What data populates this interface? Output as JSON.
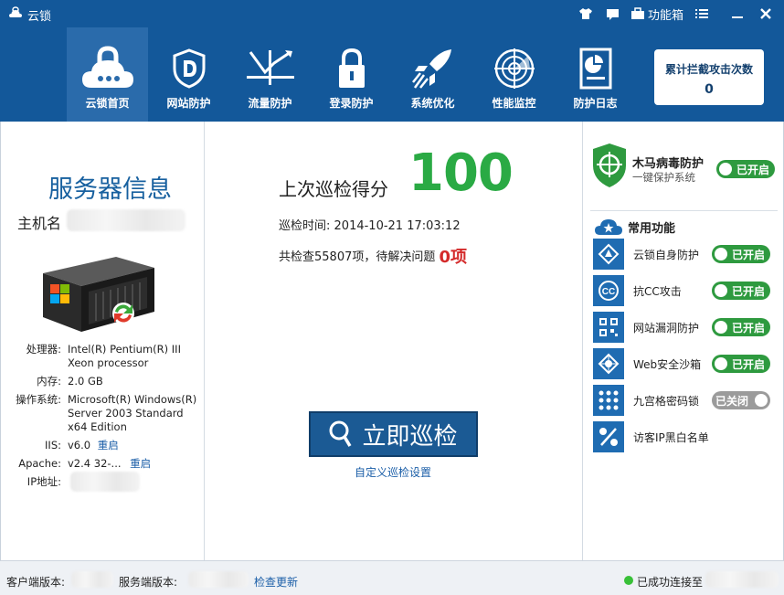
{
  "app": {
    "title": "云锁"
  },
  "titlebar": {
    "toolbox_label": "功能箱"
  },
  "nav": [
    {
      "label": "云锁首页",
      "icon": "cloud-lock-icon"
    },
    {
      "label": "网站防护",
      "icon": "shield-d-icon"
    },
    {
      "label": "流量防护",
      "icon": "traffic-icon"
    },
    {
      "label": "登录防护",
      "icon": "padlock-icon"
    },
    {
      "label": "系统优化",
      "icon": "rocket-icon"
    },
    {
      "label": "性能监控",
      "icon": "radar-icon"
    },
    {
      "label": "防护日志",
      "icon": "log-icon"
    }
  ],
  "attack_counter": {
    "label": "累计拦截攻击次数",
    "count": "0"
  },
  "server": {
    "title": "服务器信息",
    "host_label": "主机名",
    "specs": [
      {
        "key": "处理器:",
        "value": "Intel(R) Pentium(R) III Xeon processor"
      },
      {
        "key": "内存:",
        "value": "2.0 GB"
      },
      {
        "key": "操作系统:",
        "value": "Microsoft(R) Windows(R) Server 2003 Standard x64 Edition"
      },
      {
        "key": "IIS:",
        "value": "v6.0",
        "action": "重启"
      },
      {
        "key": "Apache:",
        "value": "v2.4 32-...",
        "action": "重启"
      },
      {
        "key": "IP地址:",
        "value": ""
      }
    ]
  },
  "check": {
    "score_label": "上次巡检得分",
    "score": "100",
    "time_label": "巡检时间:",
    "time_value": "2014-10-21 17:03:12",
    "summary_prefix": "共检查55807项，待解决问题",
    "issues": "0项",
    "scan_button": "立即巡检",
    "custom_link": "自定义巡检设置"
  },
  "trojan": {
    "title": "木马病毒防护",
    "subtitle": "一键保护系统",
    "status": "已开启"
  },
  "common": {
    "title": "常用功能",
    "items": [
      {
        "label": "云锁自身防护",
        "status": "已开启",
        "on": true,
        "icon": "self-protect-icon"
      },
      {
        "label": "抗CC攻击",
        "status": "已开启",
        "on": true,
        "icon": "cc-icon"
      },
      {
        "label": "网站漏洞防护",
        "status": "已开启",
        "on": true,
        "icon": "qr-icon"
      },
      {
        "label": "Web安全沙箱",
        "status": "已开启",
        "on": true,
        "icon": "sandbox-icon"
      },
      {
        "label": "九宫格密码锁",
        "status": "已关闭",
        "on": false,
        "icon": "grid-lock-icon"
      },
      {
        "label": "访客IP黑白名单",
        "status": "",
        "on": null,
        "icon": "percent-icon"
      }
    ]
  },
  "footer": {
    "client_label": "客户端版本:",
    "server_label": "服务端版本:",
    "update_link": "检查更新",
    "connected_label": "已成功连接至"
  },
  "colors": {
    "header": "#13589a",
    "accent_green": "#2aaa44",
    "toggle_on": "#2e9a3f",
    "issue_red": "#d42a2a"
  }
}
